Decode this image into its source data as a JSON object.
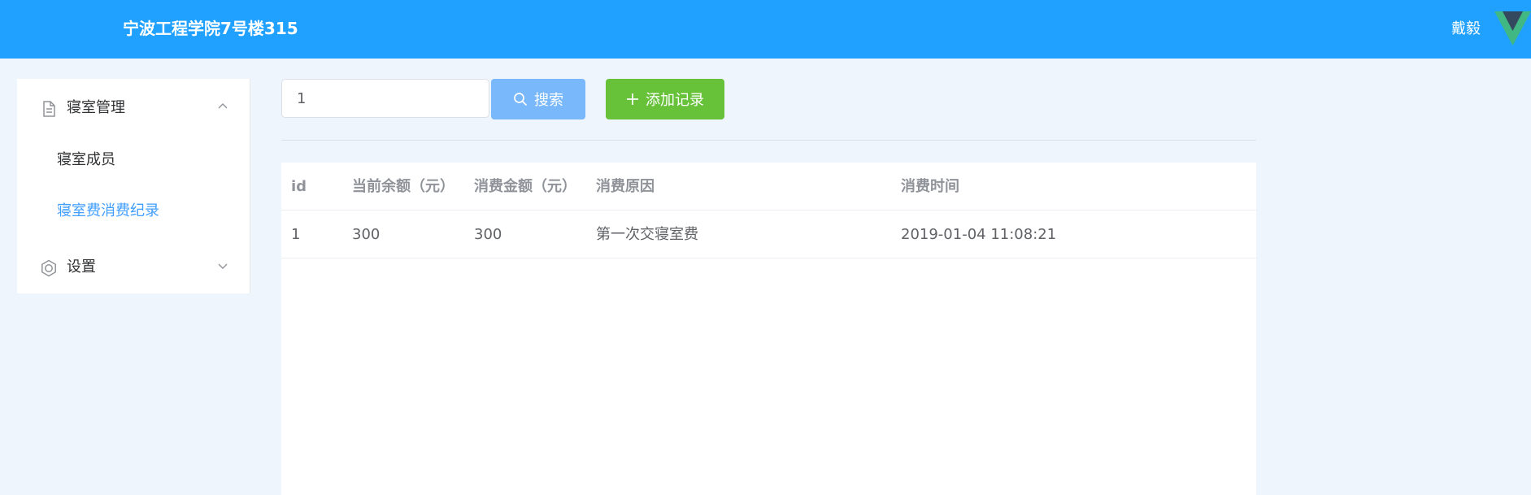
{
  "header": {
    "title": "宁波工程学院7号楼315",
    "user_name": "戴毅",
    "logo_icon": "vue-logo-icon"
  },
  "sidebar": {
    "menus": [
      {
        "label": "寝室管理",
        "icon": "document-icon",
        "expanded": true,
        "children": [
          {
            "label": "寝室成员",
            "active": false
          },
          {
            "label": "寝室费消费纪录",
            "active": true
          }
        ]
      },
      {
        "label": "设置",
        "icon": "gear-icon",
        "expanded": false
      }
    ]
  },
  "toolbar": {
    "search_value": "1",
    "search_label": "搜索",
    "add_label": "添加记录"
  },
  "table": {
    "columns": [
      "id",
      "当前余额（元）",
      "消费金额（元）",
      "消费原因",
      "消费时间"
    ],
    "rows": [
      [
        "1",
        "300",
        "300",
        "第一次交寝室费",
        "2019-01-04 11:08:21"
      ]
    ]
  },
  "colors": {
    "header_bg": "#20a0ff",
    "active_menu": "#409eff",
    "search_button": "#79b8fb",
    "add_button": "#67c23a"
  }
}
